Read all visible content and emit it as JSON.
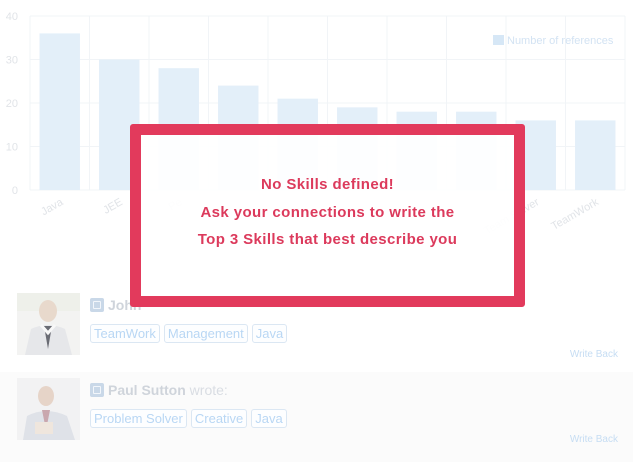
{
  "chart_data": {
    "type": "bar",
    "categories": [
      "Java",
      "JEE",
      "Pe",
      "",
      "",
      "",
      "",
      "",
      "Team Solver",
      "TeamWork"
    ],
    "values": [
      36,
      30,
      28,
      24,
      21,
      19,
      18,
      18,
      16,
      16
    ],
    "series": [
      {
        "name": "Number of references",
        "values": [
          36,
          30,
          28,
          24,
          21,
          19,
          18,
          18,
          16,
          16
        ]
      }
    ],
    "ylim": [
      0,
      40
    ],
    "yticks": [
      0,
      10,
      20,
      30,
      40
    ],
    "grid": true,
    "legend": "top-right",
    "bar_color": "#e3eff9",
    "grid_color": "#f1f4f7",
    "label_color": "#e1e4e8"
  },
  "references": [
    {
      "author": "John",
      "verb": "",
      "skills": [
        "TeamWork",
        "Management",
        "Java"
      ],
      "write_back": "Write Back"
    },
    {
      "author": "Paul Sutton",
      "verb": "wrote:",
      "skills": [
        "Problem Solver",
        "Creative",
        "Java"
      ],
      "write_back": "Write Back"
    }
  ],
  "overlay": {
    "line1": "No Skills defined!",
    "line2": "Ask your connections to write the",
    "line3": "Top 3 Skills that best describe you",
    "color": "#e23a5c"
  },
  "icons": {
    "linkedin": "linkedin-icon"
  }
}
